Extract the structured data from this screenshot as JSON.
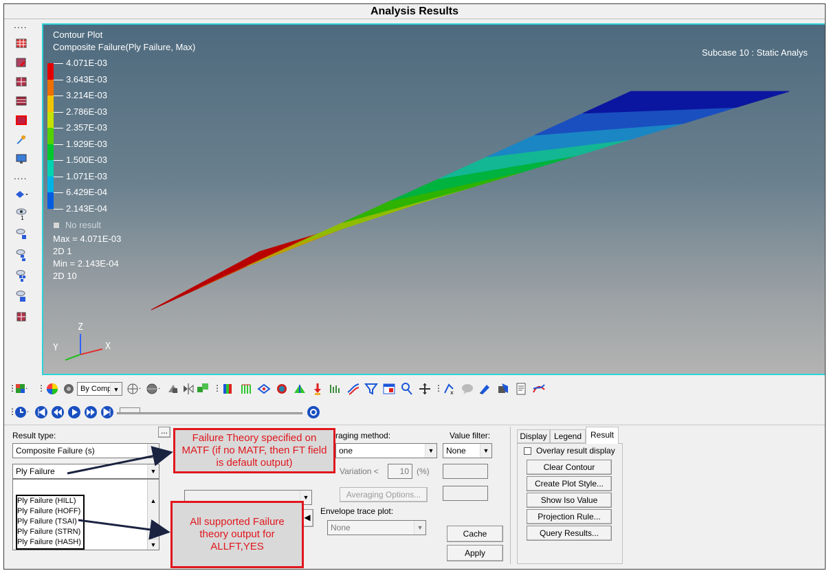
{
  "window": {
    "title": "Analysis Results"
  },
  "legend": {
    "plot_type": "Contour Plot",
    "result": "Composite Failure(Ply Failure, Max)",
    "levels": [
      {
        "value": "4.071E-03",
        "color": "#e50000"
      },
      {
        "value": "3.643E-03",
        "color": "#ee6e00"
      },
      {
        "value": "3.214E-03",
        "color": "#f0c400"
      },
      {
        "value": "2.786E-03",
        "color": "#c5e200"
      },
      {
        "value": "2.357E-03",
        "color": "#53d200"
      },
      {
        "value": "1.929E-03",
        "color": "#00c82c"
      },
      {
        "value": "1.500E-03",
        "color": "#00d3b1"
      },
      {
        "value": "1.071E-03",
        "color": "#00b2e8"
      },
      {
        "value": "6.429E-04",
        "color": "#005ce0"
      },
      {
        "value": "2.143E-04",
        "color": "#0000c8"
      }
    ],
    "no_result": "No result",
    "max_line": "Max = 4.071E-03",
    "max_elem": "2D 1",
    "min_line": "Min = 2.143E-04",
    "min_elem": "2D 10",
    "subcase": "Subcase 10 : Static Analys"
  },
  "model_strips": [
    "#b80000",
    "#c24d00",
    "#b9a100",
    "#8fbc00",
    "#2eb300",
    "#00b23e",
    "#13b793",
    "#1a86c4",
    "#1a4fc0",
    "#0a16a0"
  ],
  "triad": {
    "z": "Z",
    "y": "Y",
    "x": "X"
  },
  "toolbar": {
    "by_comp": "By Comp"
  },
  "panel": {
    "result_type_label": "Result type:",
    "result_type_value": "Composite Failure (s)",
    "ply_failure_value": "Ply Failure",
    "ply_list": [
      "Ply Failure (HILL)",
      "Ply Failure (HOFF)",
      "Ply Failure (TSAI)",
      "Ply Failure (STRN)",
      "Ply Failure (HASH)"
    ],
    "ellipsis": "...",
    "averaging_label": "raging method:",
    "averaging_value": "one",
    "variation_label": "Variation <",
    "variation_value": "10",
    "variation_unit": "(%)",
    "averaging_options": "Averaging Options...",
    "envelope_label": "Envelope trace plot:",
    "envelope_value": "None",
    "value_filter_label": "Value filter:",
    "value_filter_value": "None",
    "cache": "Cache",
    "apply": "Apply",
    "tabs": [
      "Display",
      "Legend",
      "Result"
    ],
    "overlay": "Overlay result display",
    "buttons": [
      "Clear Contour",
      "Create Plot Style...",
      "Show Iso Value",
      "Projection Rule...",
      "Query Results..."
    ]
  },
  "callouts": {
    "theory": "Failure Theory specified on MATF (if no MATF, then FT field is default output)",
    "all": "All supported Failure theory output for ALLFT,YES"
  }
}
